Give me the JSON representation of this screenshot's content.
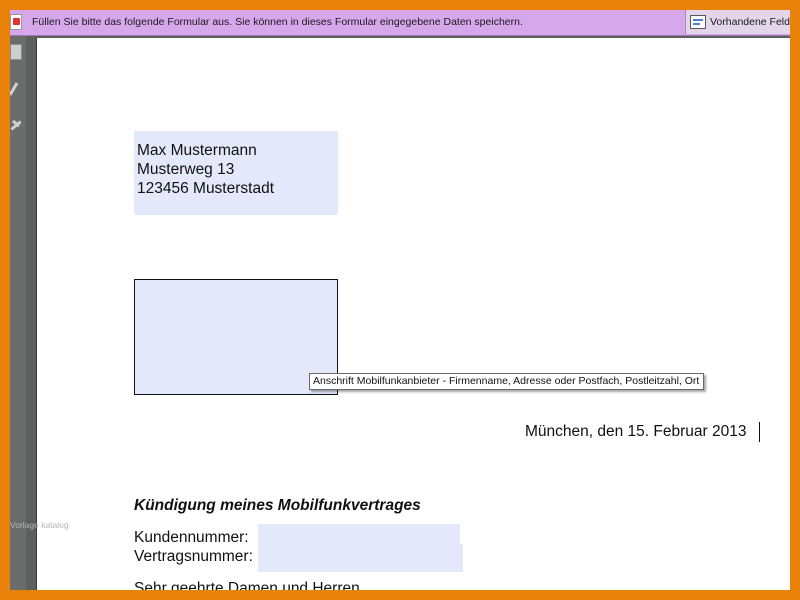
{
  "notification_bar": {
    "message": "Füllen Sie bitte das folgende Formular aus. Sie können in dieses Formular eingegebene Daten speichern.",
    "highlight_button_label": "Vorhandene Feld",
    "icon": "pdf-document-icon"
  },
  "side_toolbar": {
    "icons": [
      "pages-icon",
      "pen-icon",
      "sign-icon"
    ]
  },
  "document": {
    "sender": {
      "name": "Max Mustermann",
      "street": "Musterweg 13",
      "city": "123456 Musterstadt"
    },
    "recipient_value": "",
    "recipient_tooltip": "Anschrift Mobilfunkanbieter - Firmenname, Adresse oder Postfach, Postleitzahl, Ort",
    "date_line": "München, den 15. Februar 2013",
    "subject": "Kündigung meines Mobilfunkvertrages",
    "customer_number_label": "Kundennummer:",
    "customer_number_value": "",
    "contract_number_label": "Vertragsnummer:",
    "contract_number_value": "",
    "salutation": "Sehr geehrte Damen und Herren",
    "watermark": "Vorlage katalog"
  },
  "colors": {
    "frame": "#e8820a",
    "notification_bar": "#d7a7ec",
    "form_field": "#e3e9fb",
    "viewer_background": "#5d5e5e"
  }
}
